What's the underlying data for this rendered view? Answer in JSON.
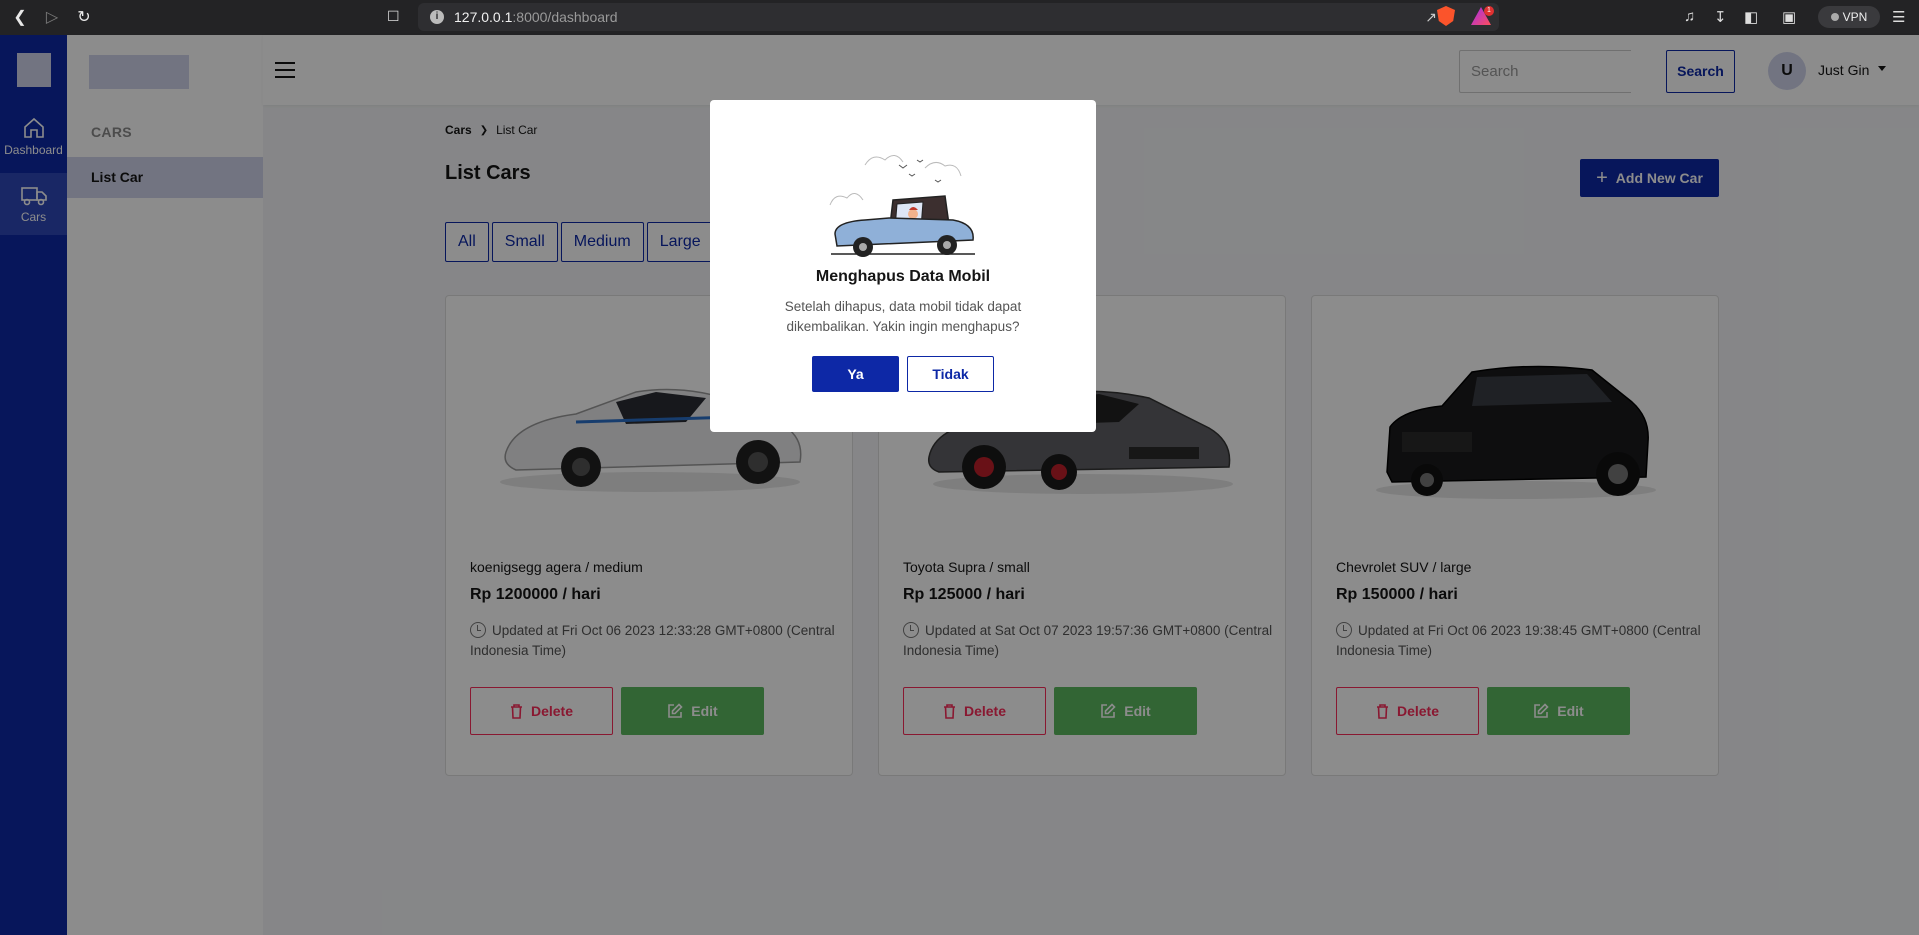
{
  "browser": {
    "url_host": "127.0.0.1",
    "url_path": ":8000/dashboard",
    "rewards_badge": "1",
    "vpn_label": "VPN"
  },
  "rail": {
    "items": [
      {
        "label": "Dashboard",
        "icon": "home-icon"
      },
      {
        "label": "Cars",
        "icon": "truck-icon"
      }
    ]
  },
  "panel": {
    "heading": "CARS",
    "item": "List Car"
  },
  "topbar": {
    "search_placeholder": "Search",
    "search_button": "Search",
    "avatar_initial": "U",
    "user_name": "Just Gin"
  },
  "main": {
    "breadcrumb": {
      "parent": "Cars",
      "current": "List Car"
    },
    "title": "List Cars",
    "add_button": "Add New Car",
    "filters": [
      "All",
      "Small",
      "Medium",
      "Large"
    ],
    "cars": [
      {
        "name": "koenigsegg agera / medium",
        "price": "Rp 1200000 / hari",
        "updated": "Updated at Fri Oct 06 2023 12:33:28 GMT+0800 (Central Indonesia Time)",
        "delete_label": "Delete",
        "edit_label": "Edit",
        "body_color": "#e9e9ec"
      },
      {
        "name": "Toyota Supra / small",
        "price": "Rp 125000 / hari",
        "updated": "Updated at Sat Oct 07 2023 19:57:36 GMT+0800 (Central Indonesia Time)",
        "delete_label": "Delete",
        "edit_label": "Edit",
        "body_color": "#5f6064"
      },
      {
        "name": "Chevrolet SUV / large",
        "price": "Rp 150000 / hari",
        "updated": "Updated at Fri Oct 06 2023 19:38:45 GMT+0800 (Central Indonesia Time)",
        "delete_label": "Delete",
        "edit_label": "Edit",
        "body_color": "#1b1b1d"
      }
    ]
  },
  "modal": {
    "title": "Menghapus Data Mobil",
    "text": "Setelah dihapus, data mobil tidak dapat dikembalikan. Yakin ingin menghapus?",
    "confirm": "Ya",
    "cancel": "Tidak"
  },
  "colors": {
    "primary": "#0d28a6",
    "danger": "#fa2c5a",
    "success": "#5cb85f",
    "light_primary": "#cfd4ec"
  }
}
